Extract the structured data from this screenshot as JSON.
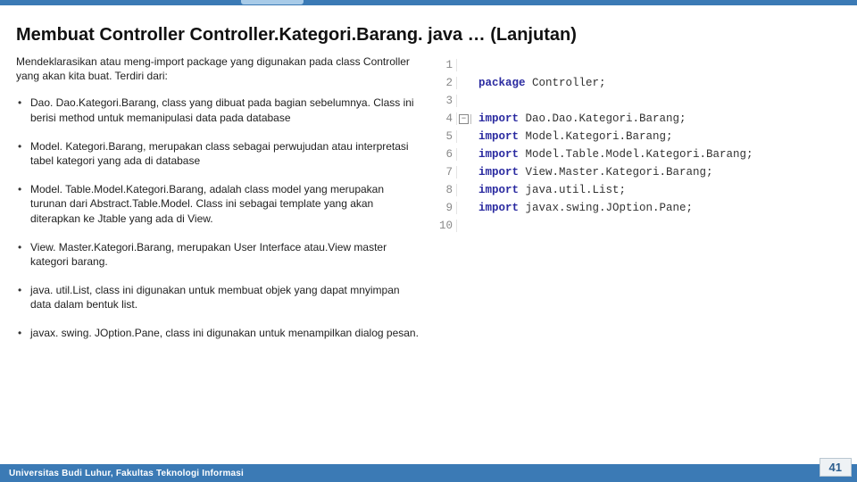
{
  "title": "Membuat Controller Controller.Kategori.Barang. java … (Lanjutan)",
  "intro": "Mendeklarasikan atau meng-import package yang digunakan pada class Controller yang akan kita buat. Terdiri dari:",
  "bullets": [
    "Dao. Dao.Kategori.Barang, class yang dibuat pada bagian sebelumnya. Class ini berisi method untuk memanipulasi data pada database",
    "Model. Kategori.Barang, merupakan class sebagai perwujudan atau interpretasi tabel kategori yang ada di database",
    "Model. Table.Model.Kategori.Barang, adalah class model yang merupakan turunan dari Abstract.Table.Model. Class ini sebagai template yang akan diterapkan ke Jtable yang ada di View.",
    "View. Master.Kategori.Barang, merupakan User Interface atau.View master kategori barang.",
    "java. util.List, class ini digunakan untuk membuat objek yang dapat mnyimpan data dalam bentuk list.",
    "javax. swing. JOption.Pane, class ini digunakan untuk menampilkan dialog pesan."
  ],
  "code": {
    "lines": [
      {
        "n": "1",
        "fold": "",
        "kw": "",
        "rest": ""
      },
      {
        "n": "2",
        "fold": "",
        "kw": "package",
        "rest": " Controller;"
      },
      {
        "n": "3",
        "fold": "",
        "kw": "",
        "rest": ""
      },
      {
        "n": "4",
        "fold": "box",
        "kw": "import",
        "rest": " Dao.Dao.Kategori.Barang;"
      },
      {
        "n": "5",
        "fold": "line",
        "kw": "import",
        "rest": " Model.Kategori.Barang;"
      },
      {
        "n": "6",
        "fold": "line",
        "kw": "import",
        "rest": " Model.Table.Model.Kategori.Barang;"
      },
      {
        "n": "7",
        "fold": "line",
        "kw": "import",
        "rest": " View.Master.Kategori.Barang;"
      },
      {
        "n": "8",
        "fold": "line",
        "kw": "import",
        "rest": " java.util.List;"
      },
      {
        "n": "9",
        "fold": "line",
        "kw": "import",
        "rest": " javax.swing.JOption.Pane;"
      },
      {
        "n": "10",
        "fold": "",
        "kw": "",
        "rest": ""
      }
    ]
  },
  "footer": "Universitas Budi Luhur, Fakultas Teknologi Informasi",
  "pagenum": "41"
}
